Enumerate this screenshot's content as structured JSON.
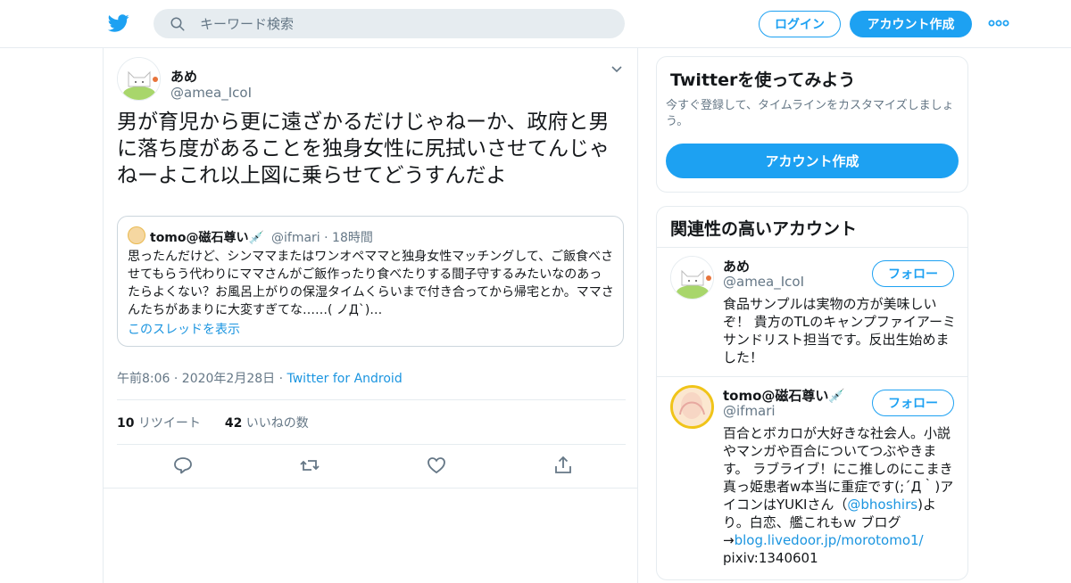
{
  "header": {
    "search_placeholder": "キーワード検索",
    "login_label": "ログイン",
    "signup_label": "アカウント作成",
    "accent_color": "#1da1f2"
  },
  "tweet": {
    "author_name": "あめ",
    "author_handle": "@amea_IcoI",
    "text": "男が育児から更に遠ざかるだけじゃねーか、政府と男に落ち度があることを独身女性に尻拭いさせてんじゃねーよこれ以上図に乗らせてどうすんだよ",
    "quote": {
      "author_name": "tomo@磁石尊い💉",
      "author_handle": "@ifmari",
      "time": "18時間",
      "text": "思ったんだけど、シンママまたはワンオペママと独身女性マッチングして、ご飯食べさせてもらう代わりにママさんがご飯作ったり食べたりする間子守するみたいなのあったらよくない？お風呂上がりの保湿タイムくらいまで付き合ってから帰宅とか。ママさんたちがあまりに大変すぎてな……( ノД`)…",
      "thread_link": "このスレッドを表示"
    },
    "timestamp": "午前8:06 · 2020年2月28日",
    "source": "Twitter for Android",
    "retweets_count": "10",
    "retweets_label": "リツイート",
    "likes_count": "42",
    "likes_label": "いいねの数"
  },
  "sidebar": {
    "signup_card": {
      "title": "Twitterを使ってみよう",
      "subtitle": "今すぐ登録して、タイムラインをカスタマイズしましょう。",
      "button_label": "アカウント作成"
    },
    "related": {
      "title": "関連性の高いアカウント",
      "accounts": [
        {
          "name": "あめ",
          "handle": "@amea_IcoI",
          "follow_label": "フォロー",
          "bio": "食品サンプルは実物の方が美味しいぞ！ 貴方のTLのキャンプファイアーミサンドリスト担当です。反出生始めました！"
        },
        {
          "name": "tomo@磁石尊い💉",
          "handle": "@ifmari",
          "follow_label": "フォロー",
          "bio_part1": "百合とボカロが大好きな社会人。小説やマンガや百合についてつぶやきます。 ラブライブ！にこ推しのにこまき真っ姫患者w本当に重症です(;´Д｀)アイコンはYUKIさん（",
          "bio_link1": "@bhoshirs",
          "bio_part2": ")より。白恋、艦これもｗ ブログ→",
          "bio_link2": "blog.livedoor.jp/morotomo1/",
          "bio_part3": "pixiv:1340601"
        }
      ]
    }
  }
}
